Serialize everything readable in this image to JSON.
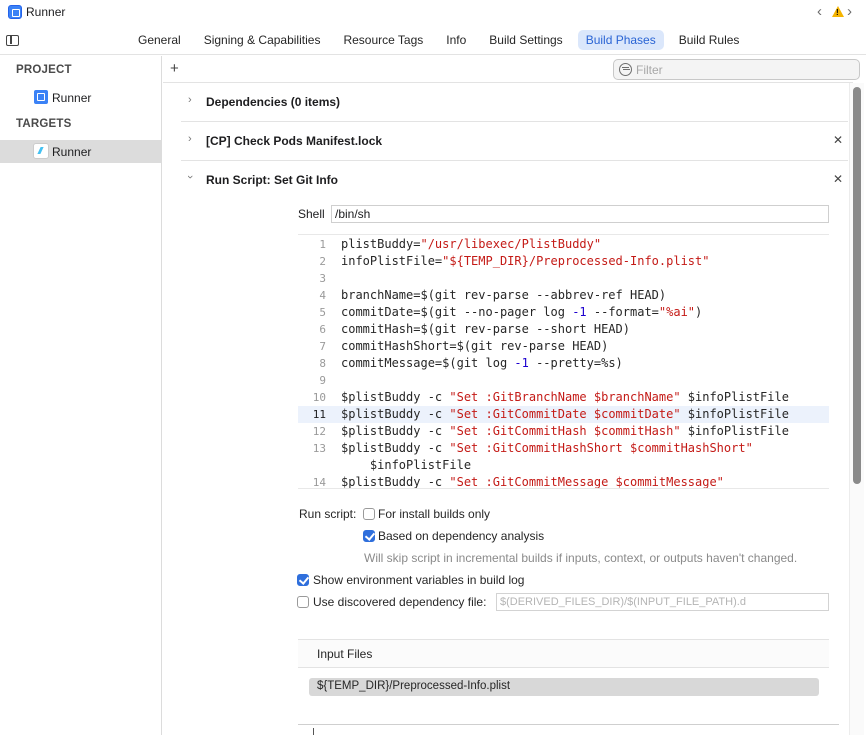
{
  "window": {
    "title": "Runner"
  },
  "tabs": [
    "General",
    "Signing & Capabilities",
    "Resource Tags",
    "Info",
    "Build Settings",
    "Build Phases",
    "Build Rules"
  ],
  "active_tab": "Build Phases",
  "sidebar": {
    "project_header": "PROJECT",
    "project_item": "Runner",
    "targets_header": "TARGETS",
    "target_item": "Runner"
  },
  "toolbar": {
    "add_label": "+",
    "filter_placeholder": "Filter"
  },
  "phases": [
    {
      "title": "Dependencies (0 items)",
      "expanded": false
    },
    {
      "title": "[CP] Check Pods Manifest.lock",
      "expanded": false
    },
    {
      "title": "Run Script: Set Git Info",
      "expanded": true
    }
  ],
  "run_script": {
    "shell_label": "Shell",
    "shell_value": "/bin/sh",
    "code_lines": [
      {
        "n": "1",
        "text": "plistBuddy=\"/usr/libexec/PlistBuddy\""
      },
      {
        "n": "2",
        "text": "infoPlistFile=\"${TEMP_DIR}/Preprocessed-Info.plist\""
      },
      {
        "n": "3",
        "text": ""
      },
      {
        "n": "4",
        "text": "branchName=$(git rev-parse --abbrev-ref HEAD)"
      },
      {
        "n": "5",
        "text": "commitDate=$(git --no-pager log -1 --format=\"%ai\")"
      },
      {
        "n": "6",
        "text": "commitHash=$(git rev-parse --short HEAD)"
      },
      {
        "n": "7",
        "text": "commitHashShort=$(git rev-parse HEAD)"
      },
      {
        "n": "8",
        "text": "commitMessage=$(git log -1 --pretty=%s)"
      },
      {
        "n": "9",
        "text": ""
      },
      {
        "n": "10",
        "text": "$plistBuddy -c \"Set :GitBranchName $branchName\" $infoPlistFile"
      },
      {
        "n": "11",
        "text": "$plistBuddy -c \"Set :GitCommitDate $commitDate\" $infoPlistFile"
      },
      {
        "n": "12",
        "text": "$plistBuddy -c \"Set :GitCommitHash $commitHash\" $infoPlistFile"
      },
      {
        "n": "13",
        "text": "$plistBuddy -c \"Set :GitCommitHashShort $commitHashShort\""
      },
      {
        "n": "",
        "text": "    $infoPlistFile"
      },
      {
        "n": "14",
        "text": "$plistBuddy -c \"Set :GitCommitMessage $commitMessage\""
      }
    ],
    "current_line": "11",
    "run_script_label": "Run script:",
    "for_install_label": "For install builds only",
    "for_install_checked": false,
    "dependency_label": "Based on dependency analysis",
    "dependency_checked": true,
    "dependency_help": "Will skip script in incremental builds if inputs, context, or outputs haven't changed.",
    "show_env_label": "Show environment variables in build log",
    "show_env_checked": true,
    "discovered_dep_label": "Use discovered dependency file:",
    "discovered_dep_checked": false,
    "discovered_dep_placeholder": "$(DERIVED_FILES_DIR)/$(INPUT_FILE_PATH).d",
    "input_files_header": "Input Files",
    "input_files": [
      "${TEMP_DIR}/Preprocessed-Info.plist"
    ]
  }
}
